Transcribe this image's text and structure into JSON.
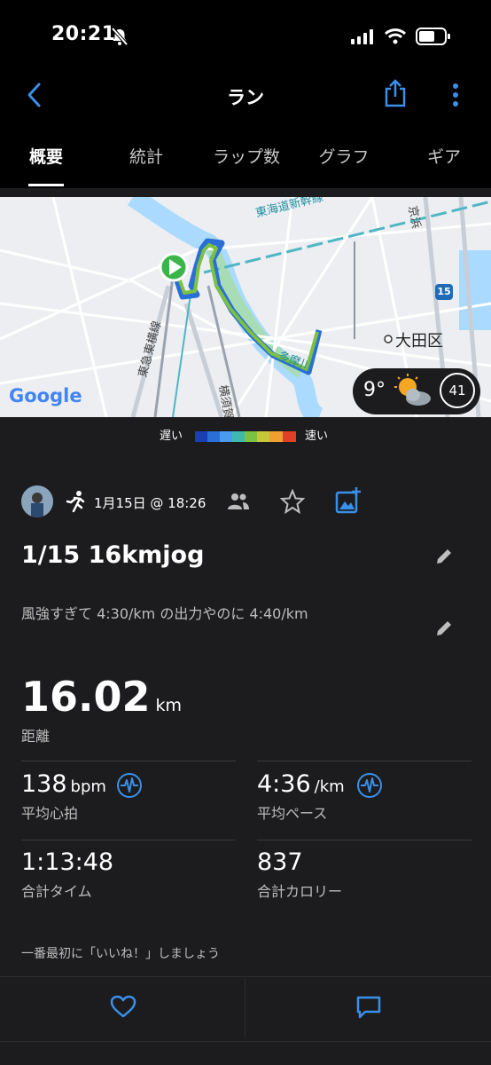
{
  "status_bar": {
    "time": "20:21"
  },
  "header": {
    "title": "ラン"
  },
  "tabs": [
    {
      "label": "概要"
    },
    {
      "label": "統計"
    },
    {
      "label": "ラップ数"
    },
    {
      "label": "グラフ"
    },
    {
      "label": "ギア"
    }
  ],
  "map": {
    "labels": {
      "shinkansen": "東海道新幹線",
      "keihin": "京浜",
      "tokyu": "東急東横線",
      "yokosuka": "横須賀",
      "tama": "多摩川",
      "ota": "大田区",
      "route15": "15",
      "google": "Google"
    },
    "weather": {
      "temp": "9°",
      "badge": "41"
    }
  },
  "speed_legend": {
    "slow": "遅い",
    "fast": "速い"
  },
  "activity": {
    "date": "1月15日 @ 18:26",
    "title": "1/15 16kmjog",
    "description": "風強すぎて 4:30/km の出力やのに 4:40/km"
  },
  "stats": {
    "distance": {
      "value": "16.02",
      "unit": "km",
      "label": "距離"
    },
    "heart_rate": {
      "value": "138",
      "unit": "bpm",
      "label": "平均心拍"
    },
    "pace": {
      "value": "4:36",
      "unit": "/km",
      "label": "平均ペース"
    },
    "time": {
      "value": "1:13:48",
      "label": "合計タイム"
    },
    "calories": {
      "value": "837",
      "label": "合計カロリー"
    }
  },
  "like_prompt": "一番最初に「いいね！」しましょう",
  "colors": {
    "accent": "#3a8fe8",
    "route_green": "#7bc142",
    "route_blue": "#2a6fd6"
  }
}
